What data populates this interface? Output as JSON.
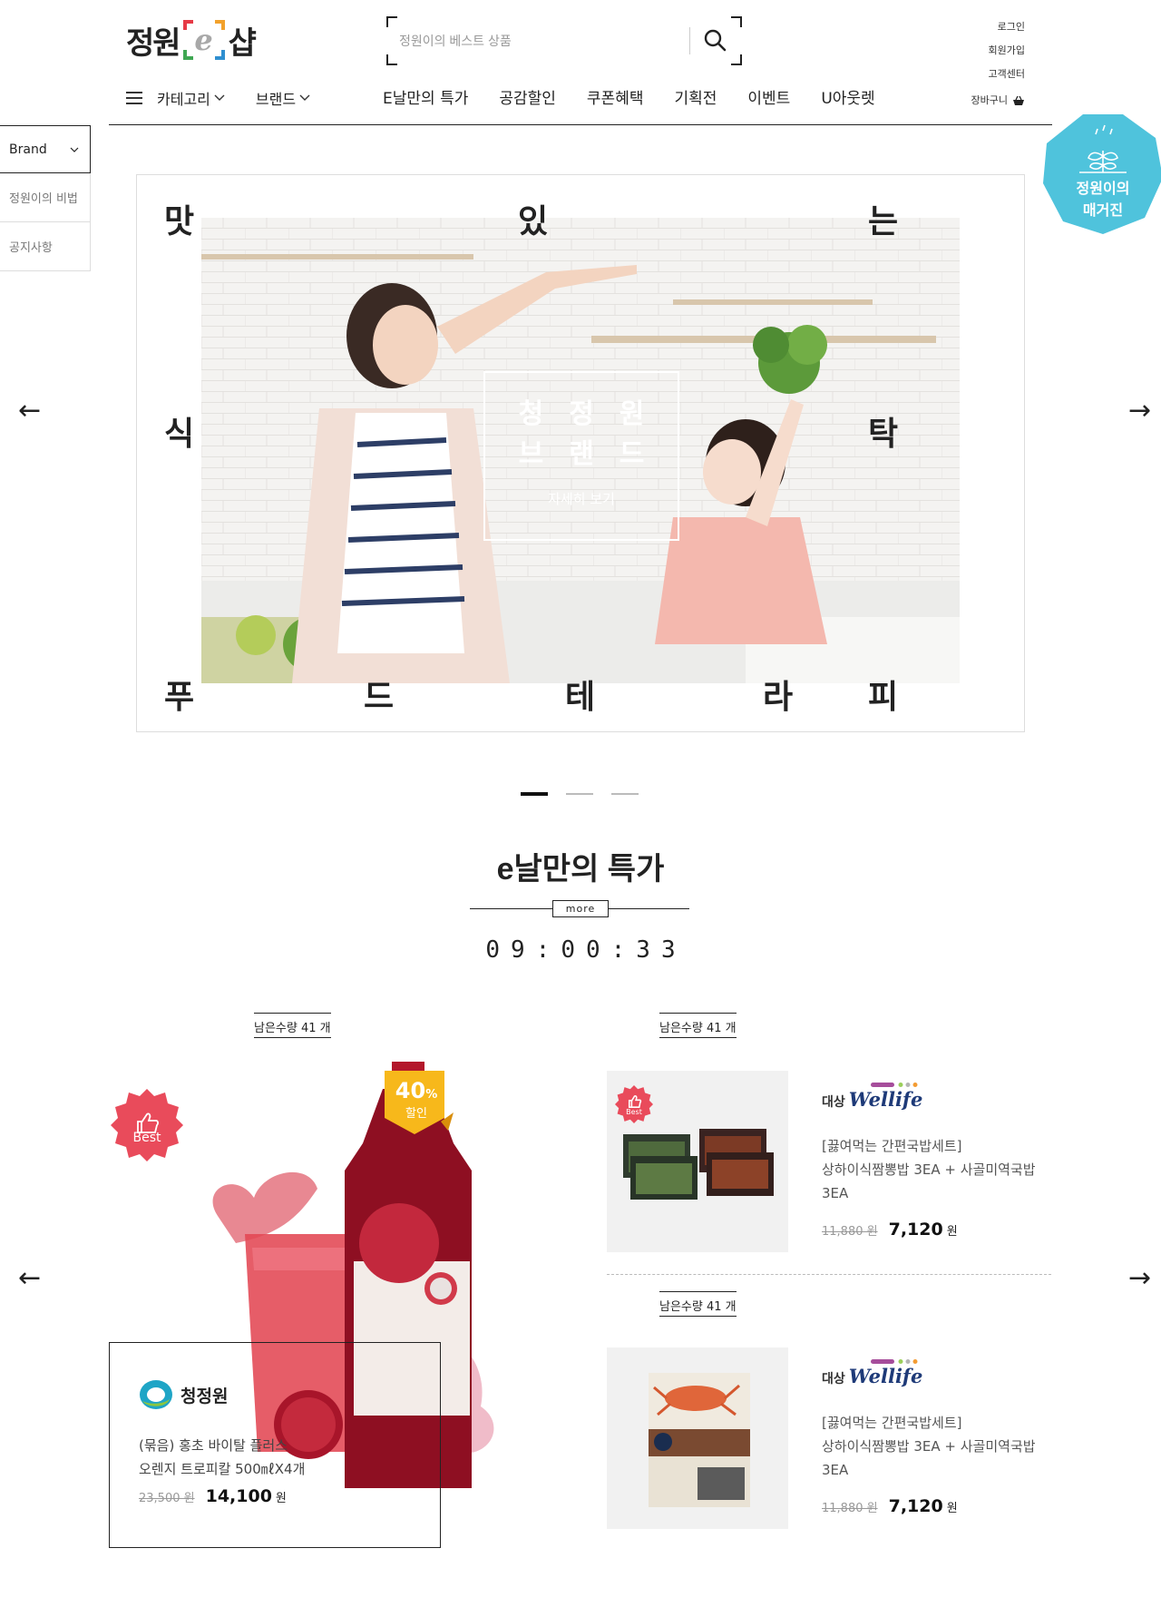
{
  "header": {
    "logo_left": "정원",
    "logo_mid": "e",
    "logo_right": "샵",
    "search_placeholder": "정원이의 베스트 상품",
    "util": [
      "로그인",
      "회원가입",
      "고객센터",
      "장바구니"
    ],
    "category_label": "카테고리",
    "brand_label": "브랜드",
    "nav": [
      "E날만의 특가",
      "공감할인",
      "쿠폰혜택",
      "기획전",
      "이벤트",
      "U아웃렛"
    ]
  },
  "side": {
    "brand": "Brand",
    "items": [
      "정원이의 비법",
      "공지사항"
    ]
  },
  "magazine": {
    "line1": "정원이의",
    "line2": "매거진"
  },
  "hero": {
    "top": [
      "맛",
      "있",
      "는"
    ],
    "mid": [
      "식",
      "탁"
    ],
    "bottom": [
      "푸",
      "드",
      "테",
      "라",
      "피"
    ],
    "box_line1": "청정원",
    "box_line2": "브랜드",
    "box_more": "자세히 보기",
    "prev": "←",
    "next": "→"
  },
  "deal": {
    "title": "e날만의 특가",
    "more": "more",
    "timer": "09:00:33",
    "prev": "←",
    "next": "→",
    "featured": {
      "remain": "남은수량 41 개",
      "badge": "Best",
      "discount_num": "40",
      "discount_pct": "%",
      "discount_word": "할인",
      "brand": "청정원",
      "name1": "(묶음) 홍초 바이탈 플러스",
      "name2": "오렌지 트로피칼 500㎖X4개",
      "old_price": "23,500 원",
      "price": "14,100",
      "won": "원"
    },
    "items": [
      {
        "remain": "남은수량 41 개",
        "badge": "Best",
        "brand_prefix": "대상",
        "brand": "Wellife",
        "name1": "[끓여먹는 간편국밥세트]",
        "name2": "상하이식짬뽕밥 3EA + 사골미역국밥",
        "name3": "3EA",
        "old_price": "11,880 원",
        "price": "7,120",
        "won": "원"
      },
      {
        "remain": "남은수량 41 개",
        "brand_prefix": "대상",
        "brand": "Wellife",
        "name1": "[끓여먹는 간편국밥세트]",
        "name2": "상하이식짬뽕밥 3EA + 사골미역국밥",
        "name3": "3EA",
        "old_price": "11,880 원",
        "price": "7,120",
        "won": "원"
      }
    ]
  },
  "colors": {
    "accent_red": "#e94b5b",
    "magazine_cyan": "#4fc3dc",
    "discount_yellow": "#f7b81b",
    "wellife_navy": "#1e3a78"
  }
}
